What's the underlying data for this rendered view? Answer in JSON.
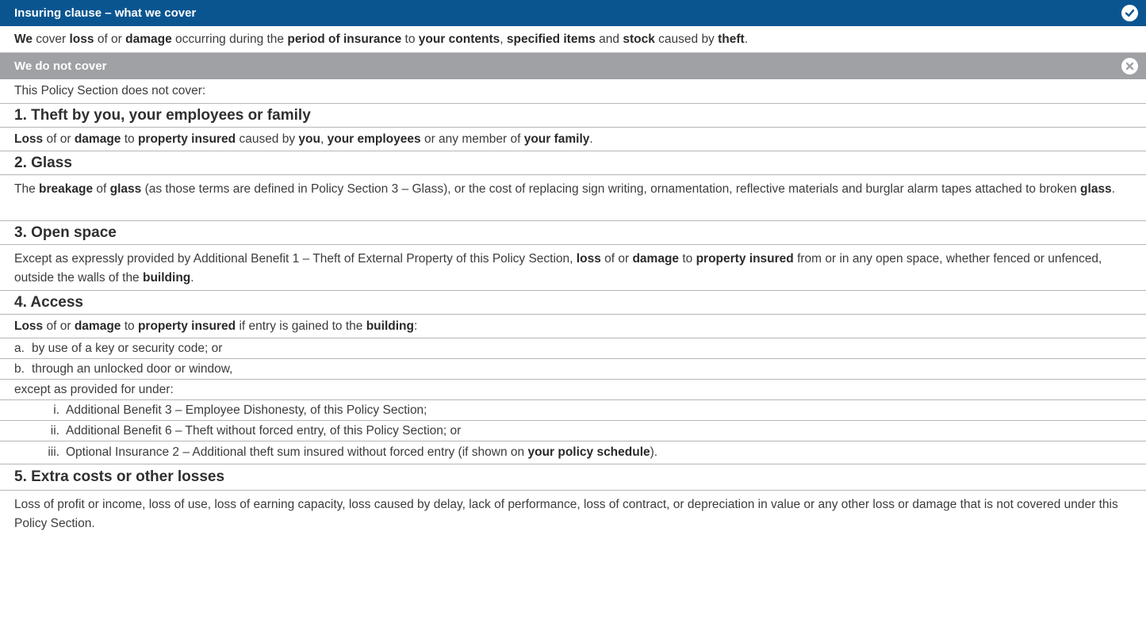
{
  "insuring_clause": {
    "header": "Insuring clause – what we cover",
    "icon": "check-circle-icon",
    "color": "#0a5590",
    "text": {
      "t1": "We",
      "t2": " cover ",
      "t3": "loss",
      "t4": " of or ",
      "t5": "damage",
      "t6": " occurring during the ",
      "t7": "period of insurance",
      "t8": " to ",
      "t9": "your contents",
      "t10": ", ",
      "t11": "specified items",
      "t12": " and ",
      "t13": "stock",
      "t14": " caused by ",
      "t15": "theft",
      "t16": "."
    }
  },
  "exclusions": {
    "header": "We do not cover",
    "icon": "x-circle-icon",
    "color": "#9fa1a4",
    "intro": "This Policy Section does not cover:",
    "items": [
      {
        "title": "1. Theft by you, your employees or family",
        "text": {
          "t1": "Loss",
          "t2": " of or ",
          "t3": "damage",
          "t4": " to ",
          "t5": "property insured",
          "t6": " caused by ",
          "t7": "you",
          "t8": ", ",
          "t9": "your employees",
          "t10": " or any member of ",
          "t11": "your family",
          "t12": "."
        }
      },
      {
        "title": "2. Glass",
        "text": {
          "t1": "The ",
          "t2": "breakage",
          "t3": " of ",
          "t4": "glass",
          "t5": " (as those terms are defined in Policy Section 3 – Glass), or the cost of replacing sign writing, ornamentation, reflective materials and burglar alarm tapes attached to broken ",
          "t6": "glass",
          "t7": "."
        }
      },
      {
        "title": "3. Open space",
        "text": {
          "t1": "Except as expressly provided by Additional Benefit 1 – Theft of External Property of this Policy Section, ",
          "t2": "loss",
          "t3": " of or ",
          "t4": "damage",
          "t5": " to ",
          "t6": "property insured",
          "t7": " from or in any open space, whether fenced or unfenced, outside the walls of the ",
          "t8": "building",
          "t9": "."
        }
      },
      {
        "title": "4. Access",
        "text": {
          "t1": "Loss",
          "t2": " of or ",
          "t3": "damage",
          "t4": " to ",
          "t5": "property insured",
          "t6": " if entry is gained to the ",
          "t7": "building",
          "t8": ":"
        },
        "sub": [
          {
            "marker": "a.",
            "text": "by use of a key or security code; or"
          },
          {
            "marker": "b.",
            "text": "through an unlocked door or window,"
          }
        ],
        "except": "except as provided for under:",
        "roman": [
          {
            "marker": "i.",
            "text": "Additional Benefit 3 – Employee Dishonesty, of this Policy Section;"
          },
          {
            "marker": "ii.",
            "text": "Additional Benefit 6 – Theft without forced entry, of this Policy Section; or"
          },
          {
            "marker": "iii.",
            "text": "Optional Insurance 2 – Additional theft sum insured without forced entry (if shown on ",
            "bold": "your policy schedule",
            "end": ")."
          }
        ]
      },
      {
        "title": "5. Extra costs or other losses",
        "text": {
          "t1": "Loss of profit or income, loss of use, loss of earning capacity, loss caused by delay, lack of performance, loss of contract, or depreciation in value or any other loss or damage that is not covered under this Policy Section."
        }
      }
    ]
  }
}
